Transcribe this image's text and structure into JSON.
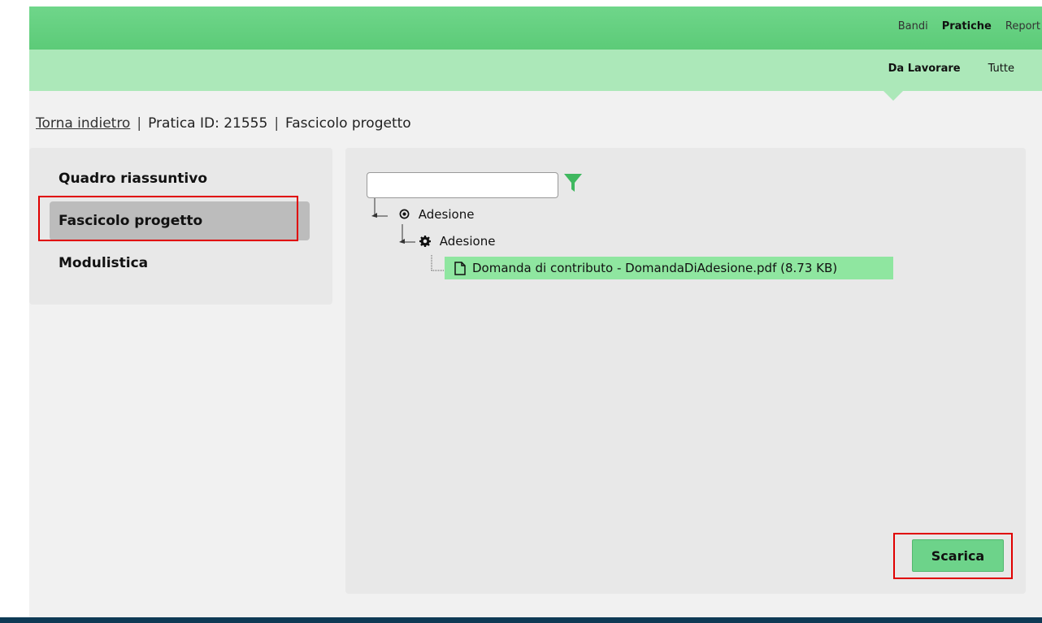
{
  "top_nav": {
    "items": [
      {
        "label": "Bandi",
        "active": false
      },
      {
        "label": "Pratiche",
        "active": true
      },
      {
        "label": "Report",
        "active": false
      }
    ]
  },
  "sub_nav": {
    "items": [
      {
        "label": "Da Lavorare",
        "active": true
      },
      {
        "label": "Tutte",
        "active": false
      }
    ]
  },
  "breadcrumb": {
    "back_link": "Torna indietro",
    "separator": "|",
    "pratica": "Pratica ID: 21555",
    "current": "Fascicolo progetto"
  },
  "sidebar": {
    "items": [
      {
        "label": "Quadro riassuntivo",
        "active": false
      },
      {
        "label": "Fascicolo progetto",
        "active": true
      },
      {
        "label": "Modulistica",
        "active": false
      }
    ]
  },
  "tree": {
    "filter_value": "",
    "filter_placeholder": "",
    "root": {
      "label": "Adesione",
      "icon": "radio-dot-icon"
    },
    "child": {
      "label": "Adesione",
      "icon": "gear-icon"
    },
    "file": {
      "label": "Domanda di contributo - DomandaDiAdesione.pdf (8.73 KB)",
      "icon": "file-icon"
    }
  },
  "actions": {
    "download_label": "Scarica"
  },
  "colors": {
    "nav_green": "#5ccb78",
    "subnav_green": "#ace8b9",
    "highlight_red": "#e00000",
    "selected_file_green": "#8fe6a0",
    "footer_blue": "#0e3a55"
  }
}
